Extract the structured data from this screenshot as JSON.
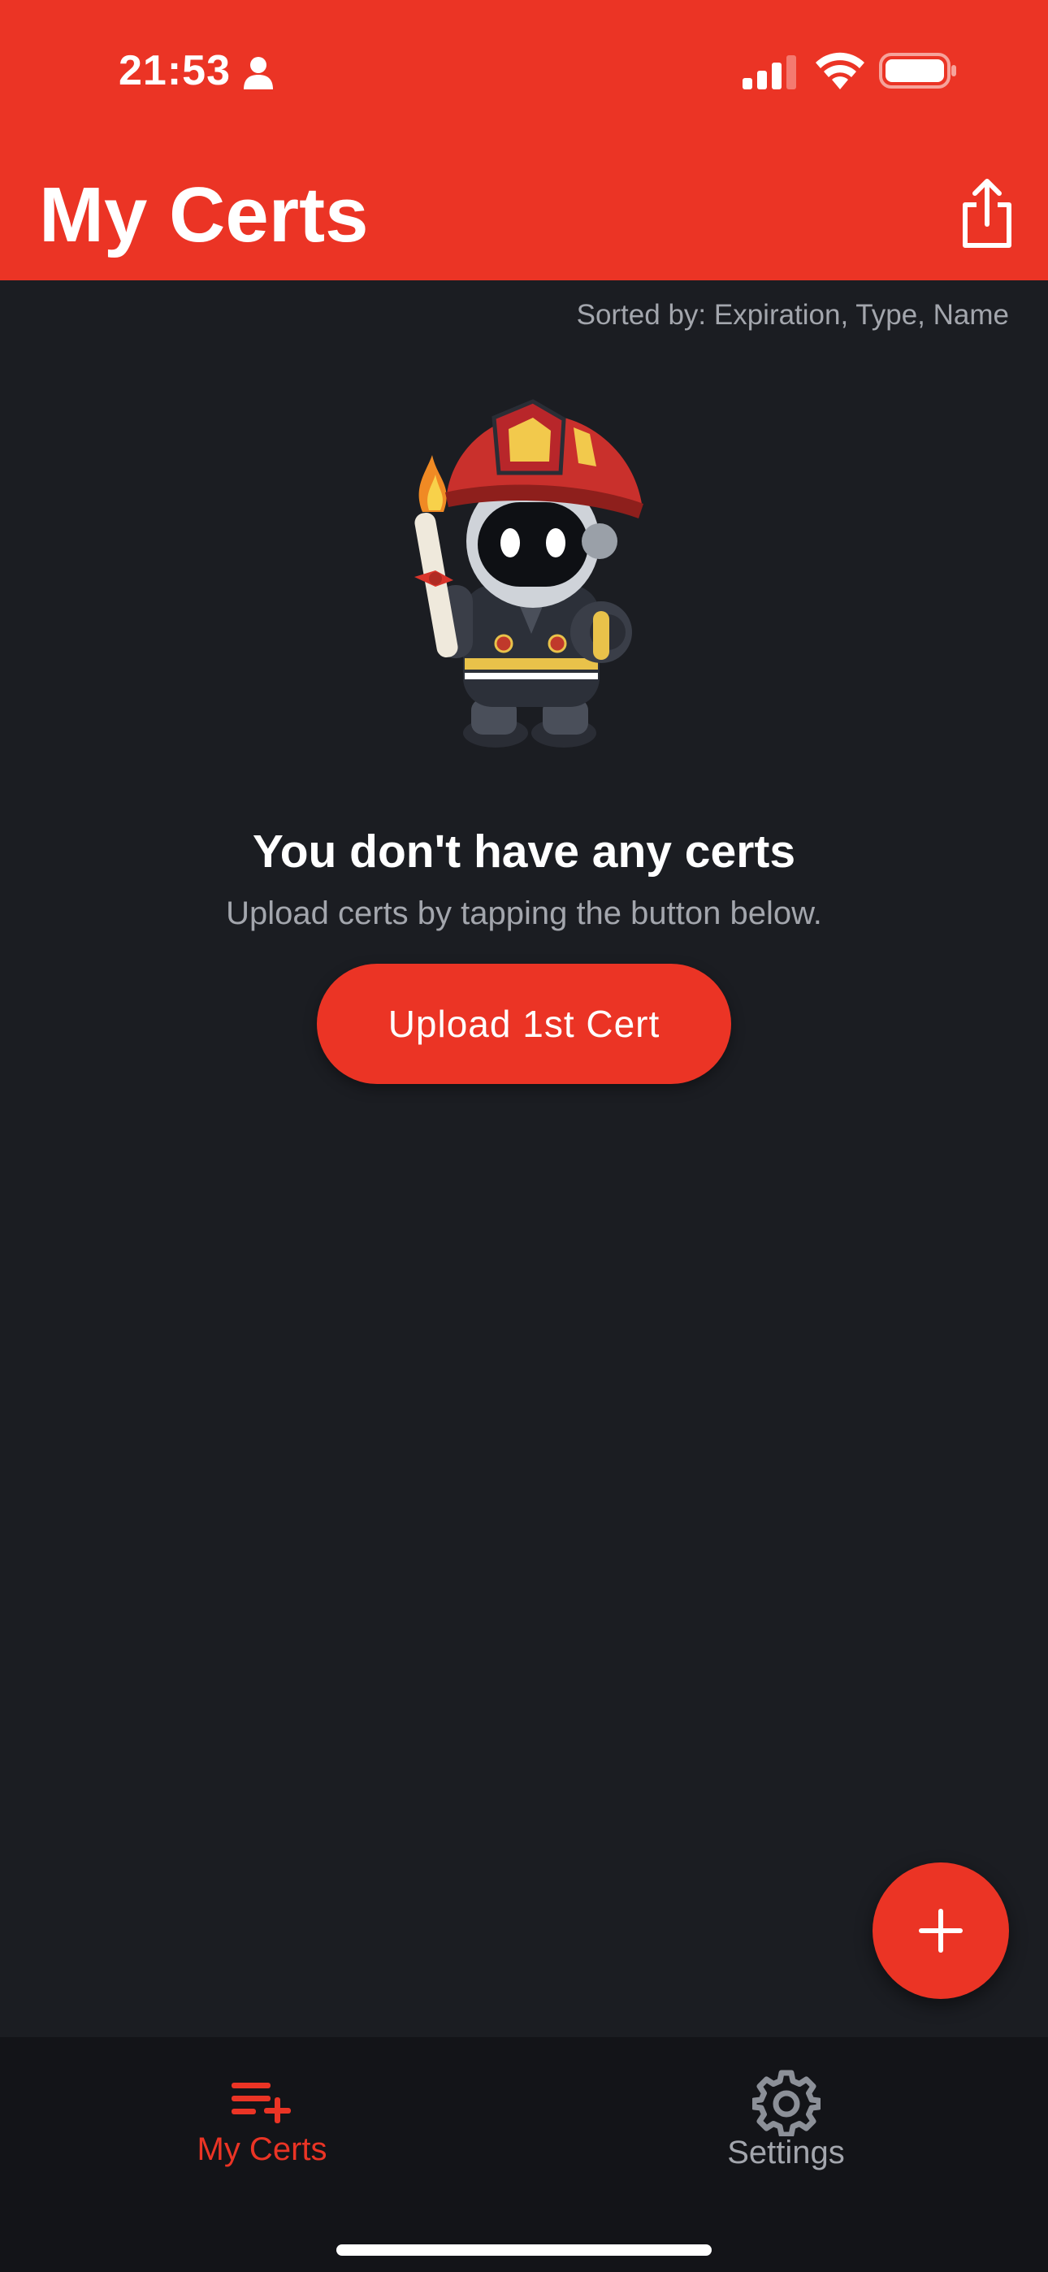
{
  "status_bar": {
    "time": "21:53"
  },
  "header": {
    "title": "My Certs",
    "share_icon": "share-icon"
  },
  "sort": {
    "label": "Sorted by: Expiration, Type, Name"
  },
  "empty_state": {
    "mascot": "firefighter-robot-mascot",
    "title": "You don't have any certs",
    "subtitle": "Upload certs by tapping the button below.",
    "button_label": "Upload 1st Cert"
  },
  "fab": {
    "icon": "plus-icon"
  },
  "tabs": [
    {
      "label": "My Certs",
      "icon": "list-add-icon",
      "active": true
    },
    {
      "label": "Settings",
      "icon": "gear-icon",
      "active": false
    }
  ],
  "colors": {
    "accent": "#eb3425",
    "background": "#1b1d22",
    "tabbar": "#131418",
    "muted_text": "#a3a6ad"
  }
}
